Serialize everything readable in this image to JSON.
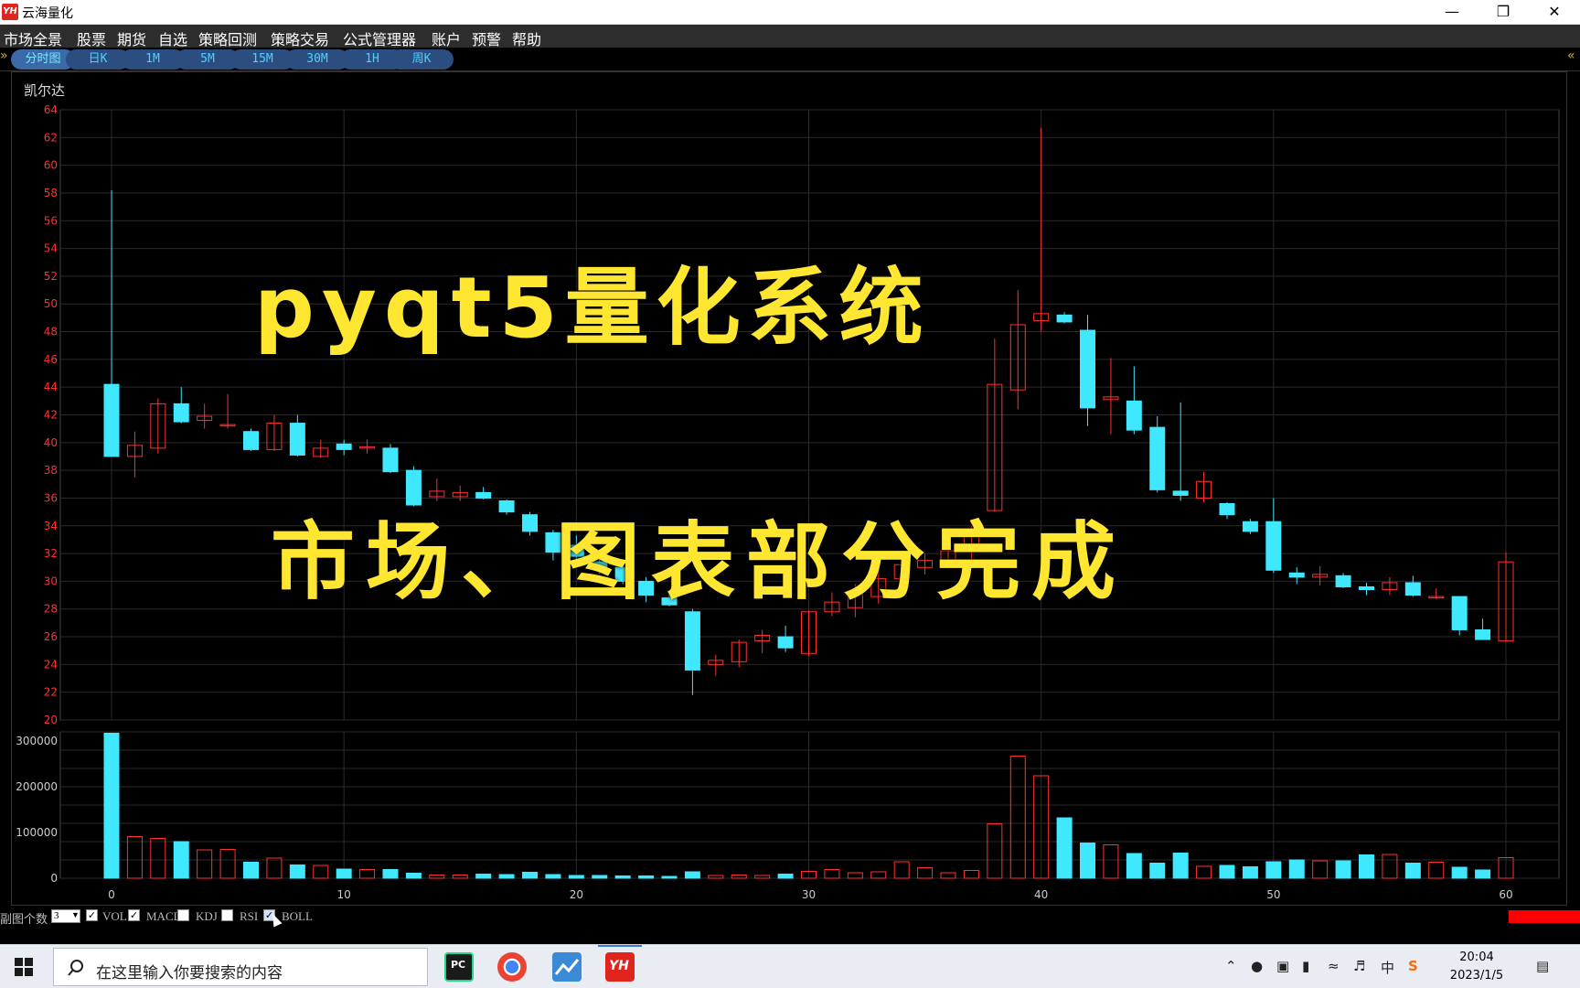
{
  "window": {
    "title": "云海量化",
    "logo": "YH"
  },
  "menu": [
    "市场全景",
    "股票",
    "期货",
    "自选",
    "策略回测",
    "策略交易",
    "公式管理器",
    "账户",
    "预警",
    "帮助"
  ],
  "tabs": [
    "分时图",
    "日K",
    "1M",
    "5M",
    "15M",
    "30M",
    "1H",
    "周K"
  ],
  "stock_name": "凯尔达",
  "overlay": {
    "line1": "pyqt5量化系统",
    "line2": "市场、图表部分完成"
  },
  "subbar": {
    "label": "副图个数",
    "count": "3",
    "options": [
      "VOL",
      "MACD",
      "KDJ",
      "RSI",
      "BOLL"
    ],
    "checked": [
      true,
      true,
      false,
      false,
      true
    ]
  },
  "taskbar": {
    "search_placeholder": "在这里输入你要搜索的内容",
    "time": "20:04",
    "date": "2023/1/5",
    "ime": "中"
  },
  "colors": {
    "up": "#ff3030",
    "down": "#40e8ff",
    "axis_price": "#ff3030",
    "grid": "#2a2a2a",
    "overlay": "#ffe630"
  },
  "chart_data": [
    {
      "type": "candlestick",
      "price_ylim": [
        20,
        64
      ],
      "price_ticks": [
        20,
        22,
        24,
        26,
        28,
        30,
        32,
        34,
        36,
        38,
        40,
        42,
        44,
        46,
        48,
        50,
        52,
        54,
        56,
        58,
        60,
        62,
        64
      ],
      "x_ticks": [
        0,
        10,
        20,
        30,
        40,
        50,
        60
      ],
      "candles": [
        [
          44.2,
          58.2,
          39,
          39
        ],
        [
          39,
          40.8,
          37.5,
          39.8
        ],
        [
          39.6,
          43.2,
          39.2,
          42.8
        ],
        [
          42.8,
          44,
          41.4,
          41.5
        ],
        [
          41.6,
          42.8,
          41,
          41.9
        ],
        [
          41.2,
          43.5,
          41,
          41.3
        ],
        [
          40.8,
          41,
          39.4,
          39.5
        ],
        [
          39.5,
          42,
          39.4,
          41.4
        ],
        [
          41.4,
          42,
          39,
          39.1
        ],
        [
          39,
          40.2,
          38.9,
          39.6
        ],
        [
          39.9,
          40.2,
          39.1,
          39.5
        ],
        [
          39.6,
          40.2,
          39.2,
          39.7
        ],
        [
          39.6,
          39.9,
          37.8,
          37.9
        ],
        [
          38,
          38.3,
          35.4,
          35.5
        ],
        [
          36.1,
          37.4,
          35.8,
          36.5
        ],
        [
          36.1,
          36.9,
          35.8,
          36.4
        ],
        [
          36.4,
          36.8,
          35.9,
          36
        ],
        [
          35.8,
          35.9,
          34.8,
          35
        ],
        [
          34.8,
          35,
          33.3,
          33.6
        ],
        [
          33.5,
          33.7,
          31.5,
          32.1
        ],
        [
          32.6,
          33.3,
          31.6,
          31.8
        ],
        [
          31.4,
          31.6,
          30.5,
          31
        ],
        [
          31,
          31.2,
          29.8,
          30
        ],
        [
          30,
          30.3,
          28.5,
          29
        ],
        [
          28.8,
          29.2,
          28.2,
          28.3
        ],
        [
          27.8,
          28,
          21.8,
          23.6
        ],
        [
          24,
          24.7,
          23.2,
          24.3
        ],
        [
          24.2,
          25.8,
          23.8,
          25.6
        ],
        [
          25.7,
          26.5,
          24.8,
          26.1
        ],
        [
          26,
          26.8,
          24.9,
          25.2
        ],
        [
          24.8,
          27.9,
          24.6,
          27.8
        ],
        [
          27.8,
          29.2,
          27.5,
          28.5
        ],
        [
          28.1,
          29.8,
          27.4,
          29.1
        ],
        [
          28.9,
          31.2,
          28.4,
          30.2
        ],
        [
          30.2,
          31.5,
          29.5,
          31.2
        ],
        [
          31,
          32,
          30.5,
          31.5
        ],
        [
          31.5,
          33,
          31,
          32.2
        ],
        [
          32.2,
          34,
          31.5,
          33.5
        ],
        [
          35.1,
          47.5,
          35,
          44.2
        ],
        [
          43.8,
          51,
          42.4,
          48.5
        ],
        [
          48.8,
          62.7,
          48,
          49.3
        ],
        [
          49.2,
          49.4,
          48.6,
          48.7
        ],
        [
          48.1,
          49.2,
          41.2,
          42.5
        ],
        [
          43.1,
          46.1,
          40.6,
          43.3
        ],
        [
          43,
          45.5,
          40.6,
          40.9
        ],
        [
          41.1,
          41.9,
          36.4,
          36.6
        ],
        [
          36.5,
          42.9,
          35.8,
          36.2
        ],
        [
          36,
          37.9,
          35.7,
          37.2
        ],
        [
          35.6,
          35.7,
          34.5,
          34.8
        ],
        [
          34.3,
          34.5,
          33.4,
          33.6
        ],
        [
          34.3,
          36,
          30.6,
          30.8
        ],
        [
          30.6,
          31,
          29.8,
          30.3
        ],
        [
          30.3,
          31.1,
          29.7,
          30.5
        ],
        [
          30.4,
          30.6,
          29.5,
          29.6
        ],
        [
          29.6,
          29.9,
          29,
          29.4
        ],
        [
          29.4,
          30.3,
          29,
          29.9
        ],
        [
          29.9,
          30.4,
          28.9,
          29
        ],
        [
          28.9,
          29.5,
          28.7,
          28.9
        ],
        [
          28.9,
          28.9,
          26.1,
          26.5
        ],
        [
          26.5,
          27.3,
          25.8,
          25.8
        ],
        [
          25.7,
          32.1,
          25.7,
          31.4
        ]
      ]
    },
    {
      "type": "bar",
      "y_ticks": [
        0,
        100000,
        200000,
        300000
      ],
      "ylim": [
        0,
        320000
      ],
      "values": [
        317000,
        91000,
        87000,
        80000,
        62000,
        63000,
        35000,
        44000,
        29000,
        28000,
        20000,
        19000,
        19000,
        11000,
        7000,
        7000,
        9000,
        8000,
        13000,
        8000,
        6000,
        6000,
        5000,
        5000,
        4000,
        14000,
        6000,
        7000,
        6000,
        9000,
        15000,
        19000,
        12000,
        14000,
        36000,
        23000,
        12000,
        17000,
        119000,
        267000,
        224000,
        132000,
        77000,
        73000,
        54000,
        33000,
        55000,
        26000,
        28000,
        25000,
        36000,
        40000,
        38000,
        38000,
        51000,
        52000,
        33000,
        35000,
        24000,
        18000,
        45000
      ]
    }
  ]
}
